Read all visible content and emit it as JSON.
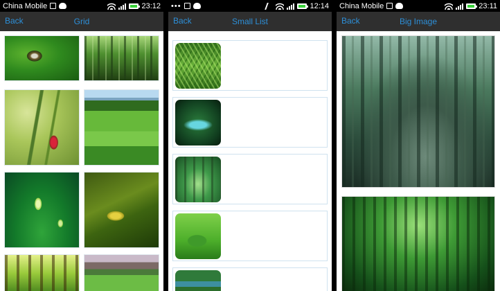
{
  "screens": [
    {
      "id": "grid",
      "status": {
        "carrier": "China Mobile",
        "time": "23:12"
      },
      "nav": {
        "back": "Back",
        "title": "Grid"
      },
      "images": [
        "leaf-drop-photo",
        "bamboo-photo",
        "poppy-photo",
        "meadow-photo",
        "lotus-photo",
        "frog-photo",
        "forest-light-photo",
        "mountain-photo"
      ]
    },
    {
      "id": "small-list",
      "status": {
        "carrier": "",
        "time": "12:14"
      },
      "nav": {
        "back": "Back",
        "title": "Small List"
      },
      "images": [
        "fern-photo",
        "stream-photo",
        "tree-tunnel-photo",
        "island-photo",
        "river-photo"
      ]
    },
    {
      "id": "big-image",
      "status": {
        "carrier": "China Mobile",
        "time": "23:11"
      },
      "nav": {
        "back": "Back",
        "title": "Big Image"
      },
      "images": [
        "forest-photo",
        "green-tunnel-photo"
      ]
    }
  ],
  "colors": {
    "accent": "#2d8fd8",
    "navbar": "#2f2f2f",
    "battery": "#3bd13b"
  }
}
